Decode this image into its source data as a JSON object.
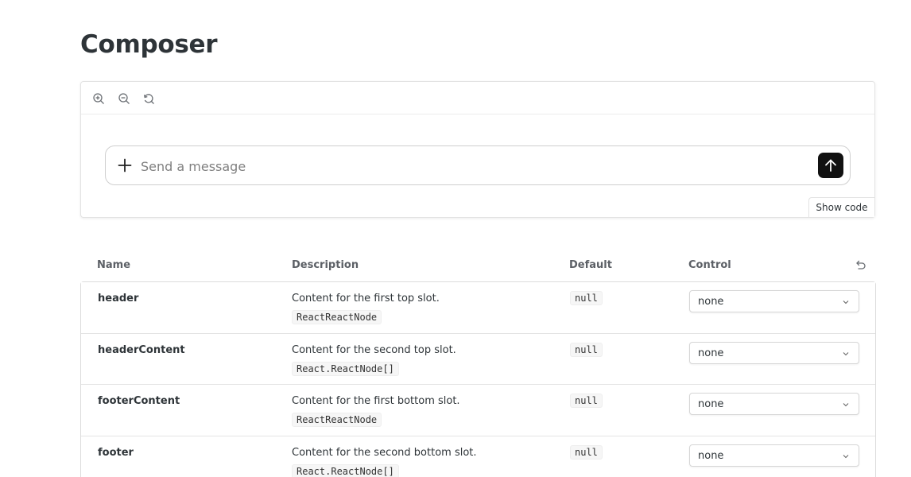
{
  "page": {
    "title": "Composer"
  },
  "preview": {
    "toolbar": {
      "zoom_in": "zoom-in-icon",
      "zoom_out": "zoom-out-icon",
      "reset_zoom": "reset-zoom-icon"
    },
    "composer": {
      "placeholder": "Send a message",
      "value": ""
    },
    "show_code_label": "Show code"
  },
  "args_table": {
    "headers": {
      "name": "Name",
      "description": "Description",
      "default": "Default",
      "control": "Control"
    },
    "rows": [
      {
        "name": "header",
        "description": "Content for the first top slot.",
        "type": "ReactReactNode",
        "default": "null",
        "control": "none"
      },
      {
        "name": "headerContent",
        "description": "Content for the second top slot.",
        "type": "React.ReactNode[]",
        "default": "null",
        "control": "none"
      },
      {
        "name": "footerContent",
        "description": "Content for the first bottom slot.",
        "type": "ReactReactNode",
        "default": "null",
        "control": "none"
      },
      {
        "name": "footer",
        "description": "Content for the second bottom slot.",
        "type": "React.ReactNode[]",
        "default": "null",
        "control": "none"
      }
    ]
  },
  "colors": {
    "send_button": "#111111",
    "border": "#dcdcdc",
    "title": "#2e3438"
  }
}
